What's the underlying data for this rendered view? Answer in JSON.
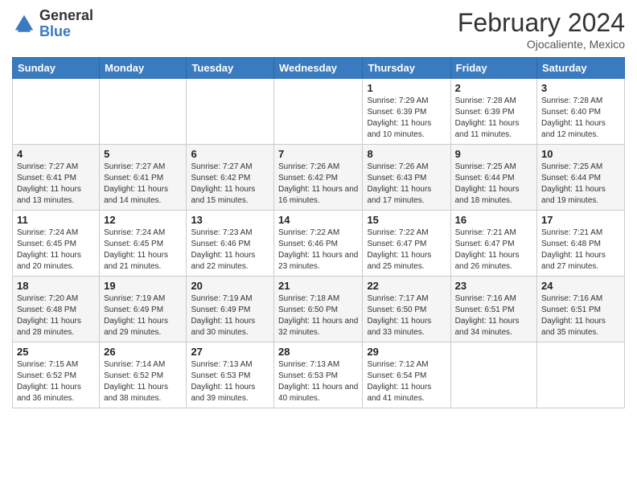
{
  "header": {
    "logo_general": "General",
    "logo_blue": "Blue",
    "month_title": "February 2024",
    "subtitle": "Ojocaliente, Mexico"
  },
  "weekdays": [
    "Sunday",
    "Monday",
    "Tuesday",
    "Wednesday",
    "Thursday",
    "Friday",
    "Saturday"
  ],
  "weeks": [
    [
      {
        "day": "",
        "info": ""
      },
      {
        "day": "",
        "info": ""
      },
      {
        "day": "",
        "info": ""
      },
      {
        "day": "",
        "info": ""
      },
      {
        "day": "1",
        "info": "Sunrise: 7:29 AM\nSunset: 6:39 PM\nDaylight: 11 hours and 10 minutes."
      },
      {
        "day": "2",
        "info": "Sunrise: 7:28 AM\nSunset: 6:39 PM\nDaylight: 11 hours and 11 minutes."
      },
      {
        "day": "3",
        "info": "Sunrise: 7:28 AM\nSunset: 6:40 PM\nDaylight: 11 hours and 12 minutes."
      }
    ],
    [
      {
        "day": "4",
        "info": "Sunrise: 7:27 AM\nSunset: 6:41 PM\nDaylight: 11 hours and 13 minutes."
      },
      {
        "day": "5",
        "info": "Sunrise: 7:27 AM\nSunset: 6:41 PM\nDaylight: 11 hours and 14 minutes."
      },
      {
        "day": "6",
        "info": "Sunrise: 7:27 AM\nSunset: 6:42 PM\nDaylight: 11 hours and 15 minutes."
      },
      {
        "day": "7",
        "info": "Sunrise: 7:26 AM\nSunset: 6:42 PM\nDaylight: 11 hours and 16 minutes."
      },
      {
        "day": "8",
        "info": "Sunrise: 7:26 AM\nSunset: 6:43 PM\nDaylight: 11 hours and 17 minutes."
      },
      {
        "day": "9",
        "info": "Sunrise: 7:25 AM\nSunset: 6:44 PM\nDaylight: 11 hours and 18 minutes."
      },
      {
        "day": "10",
        "info": "Sunrise: 7:25 AM\nSunset: 6:44 PM\nDaylight: 11 hours and 19 minutes."
      }
    ],
    [
      {
        "day": "11",
        "info": "Sunrise: 7:24 AM\nSunset: 6:45 PM\nDaylight: 11 hours and 20 minutes."
      },
      {
        "day": "12",
        "info": "Sunrise: 7:24 AM\nSunset: 6:45 PM\nDaylight: 11 hours and 21 minutes."
      },
      {
        "day": "13",
        "info": "Sunrise: 7:23 AM\nSunset: 6:46 PM\nDaylight: 11 hours and 22 minutes."
      },
      {
        "day": "14",
        "info": "Sunrise: 7:22 AM\nSunset: 6:46 PM\nDaylight: 11 hours and 23 minutes."
      },
      {
        "day": "15",
        "info": "Sunrise: 7:22 AM\nSunset: 6:47 PM\nDaylight: 11 hours and 25 minutes."
      },
      {
        "day": "16",
        "info": "Sunrise: 7:21 AM\nSunset: 6:47 PM\nDaylight: 11 hours and 26 minutes."
      },
      {
        "day": "17",
        "info": "Sunrise: 7:21 AM\nSunset: 6:48 PM\nDaylight: 11 hours and 27 minutes."
      }
    ],
    [
      {
        "day": "18",
        "info": "Sunrise: 7:20 AM\nSunset: 6:48 PM\nDaylight: 11 hours and 28 minutes."
      },
      {
        "day": "19",
        "info": "Sunrise: 7:19 AM\nSunset: 6:49 PM\nDaylight: 11 hours and 29 minutes."
      },
      {
        "day": "20",
        "info": "Sunrise: 7:19 AM\nSunset: 6:49 PM\nDaylight: 11 hours and 30 minutes."
      },
      {
        "day": "21",
        "info": "Sunrise: 7:18 AM\nSunset: 6:50 PM\nDaylight: 11 hours and 32 minutes."
      },
      {
        "day": "22",
        "info": "Sunrise: 7:17 AM\nSunset: 6:50 PM\nDaylight: 11 hours and 33 minutes."
      },
      {
        "day": "23",
        "info": "Sunrise: 7:16 AM\nSunset: 6:51 PM\nDaylight: 11 hours and 34 minutes."
      },
      {
        "day": "24",
        "info": "Sunrise: 7:16 AM\nSunset: 6:51 PM\nDaylight: 11 hours and 35 minutes."
      }
    ],
    [
      {
        "day": "25",
        "info": "Sunrise: 7:15 AM\nSunset: 6:52 PM\nDaylight: 11 hours and 36 minutes."
      },
      {
        "day": "26",
        "info": "Sunrise: 7:14 AM\nSunset: 6:52 PM\nDaylight: 11 hours and 38 minutes."
      },
      {
        "day": "27",
        "info": "Sunrise: 7:13 AM\nSunset: 6:53 PM\nDaylight: 11 hours and 39 minutes."
      },
      {
        "day": "28",
        "info": "Sunrise: 7:13 AM\nSunset: 6:53 PM\nDaylight: 11 hours and 40 minutes."
      },
      {
        "day": "29",
        "info": "Sunrise: 7:12 AM\nSunset: 6:54 PM\nDaylight: 11 hours and 41 minutes."
      },
      {
        "day": "",
        "info": ""
      },
      {
        "day": "",
        "info": ""
      }
    ]
  ]
}
